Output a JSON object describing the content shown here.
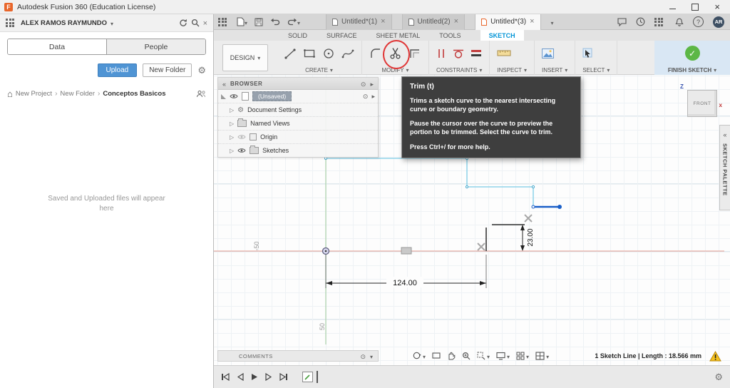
{
  "titlebar": {
    "title": "Autodesk Fusion 360 (Education License)",
    "logo_letter": "F"
  },
  "data_panel": {
    "account_name": "ALEX RAMOS RAYMUNDO",
    "tabs": {
      "data": "Data",
      "people": "People"
    },
    "actions": {
      "upload": "Upload",
      "new_folder": "New Folder"
    },
    "breadcrumb": {
      "items": [
        "New Project",
        "New Folder",
        "Conceptos Basicos"
      ]
    },
    "empty_state": "Saved and Uploaded files will appear here"
  },
  "doc_bar": {
    "tabs": [
      {
        "label": "Untitled*(1)"
      },
      {
        "label": "Untitled(2)"
      },
      {
        "label": "Untitled*(3)"
      }
    ],
    "avatar": "AR"
  },
  "ribbon": {
    "design": "DESIGN",
    "tabs": [
      "SOLID",
      "SURFACE",
      "SHEET METAL",
      "TOOLS",
      "SKETCH"
    ],
    "groups": {
      "create": "CREATE",
      "modify": "MODIFY",
      "constraints": "CONSTRAINTS",
      "inspect": "INSPECT",
      "insert": "INSERT",
      "select": "SELECT",
      "finish": "FINISH SKETCH"
    }
  },
  "browser": {
    "title": "BROWSER",
    "root": "(Unsaved)",
    "items": [
      "Document Settings",
      "Named Views",
      "Origin",
      "Sketches"
    ]
  },
  "tooltip": {
    "title": "Trim (t)",
    "body1": "Trims a sketch curve to the nearest intersecting curve or boundary geometry.",
    "body2": "Pause the cursor over the curve to preview the portion to be trimmed. Select the curve to trim.",
    "body3": "Press Ctrl+/ for more help."
  },
  "canvas": {
    "dims": {
      "width": "124.00",
      "height": "23.00"
    },
    "grid_labels": {
      "neg": "-50",
      "pos": "50"
    },
    "viewcube": {
      "face": "FRONT",
      "axis_z": "Z",
      "axis_x": "x"
    },
    "sketch_palette": "SKETCH PALETTE"
  },
  "comments": {
    "label": "COMMENTS"
  },
  "status": {
    "text": "1 Sketch Line | Length : 18.566 mm"
  },
  "colors": {
    "accent_blue": "#0696d7",
    "selection_blue": "#1a5fc8",
    "sketch_cyan": "#7ccce6",
    "axis_green": "#9ccb9c",
    "axis_red": "#e59a8e",
    "finish_green": "#5cb746",
    "annotation_red": "#e03535",
    "warning_yellow": "#f6c21c"
  }
}
